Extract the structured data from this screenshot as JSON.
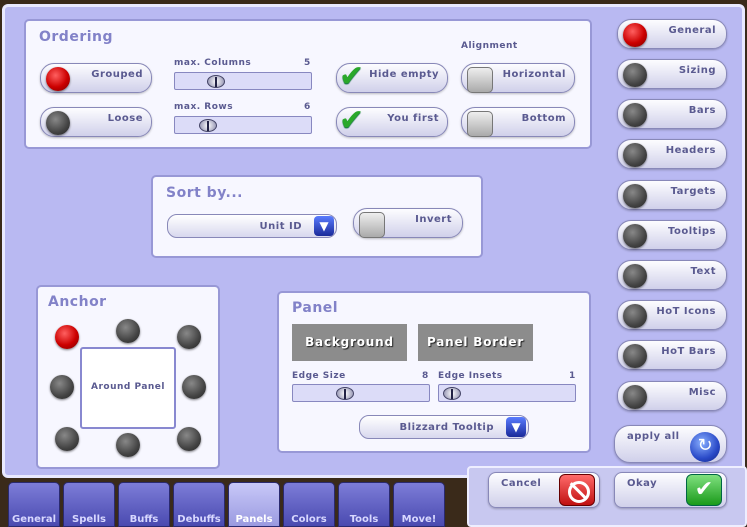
{
  "ordering": {
    "title": "Ordering",
    "grouped": "Grouped",
    "loose": "Loose",
    "max_columns_label": "max. Columns",
    "max_columns_value": "5",
    "max_rows_label": "max. Rows",
    "max_rows_value": "6",
    "hide_empty": "Hide empty",
    "you_first": "You first",
    "alignment_label": "Alignment",
    "horizontal": "Horizontal",
    "bottom": "Bottom"
  },
  "sortby": {
    "title": "Sort by...",
    "value": "Unit ID",
    "invert": "Invert"
  },
  "anchor": {
    "title": "Anchor",
    "center": "Around Panel"
  },
  "panel": {
    "title": "Panel",
    "background": "Background",
    "border": "Panel Border",
    "edge_size_label": "Edge Size",
    "edge_size_value": "8",
    "edge_insets_label": "Edge Insets",
    "edge_insets_value": "1",
    "tooltip": "Blizzard Tooltip"
  },
  "sidebar": {
    "items": [
      {
        "label": "General",
        "active": true
      },
      {
        "label": "Sizing"
      },
      {
        "label": "Bars"
      },
      {
        "label": "Headers"
      },
      {
        "label": "Targets"
      },
      {
        "label": "Tooltips"
      },
      {
        "label": "Text"
      },
      {
        "label": "HoT Icons"
      },
      {
        "label": "HoT Bars"
      },
      {
        "label": "Misc"
      }
    ]
  },
  "actions": {
    "apply_all": "apply all",
    "cancel": "Cancel",
    "okay": "Okay"
  },
  "tabs": [
    {
      "label": "General"
    },
    {
      "label": "Spells"
    },
    {
      "label": "Buffs"
    },
    {
      "label": "Debuffs"
    },
    {
      "label": "Panels",
      "active": true
    },
    {
      "label": "Colors"
    },
    {
      "label": "Tools"
    },
    {
      "label": "Move!"
    }
  ]
}
